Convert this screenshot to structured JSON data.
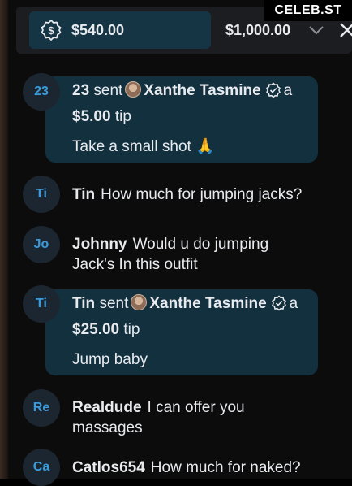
{
  "brand": "CELEB.ST",
  "tipbar": {
    "selected_amount": "$540.00",
    "other_amount": "$1,000.00",
    "icon": "tip-coin-icon"
  },
  "messages": [
    {
      "avatar": "23",
      "type": "tip",
      "user": "23",
      "sent_word": "sent",
      "recipient": "Xanthe Tasmine",
      "a_word": "a",
      "amount": "$5.00",
      "tip_word": "tip",
      "note": "Take a small shot 🙏"
    },
    {
      "avatar": "Ti",
      "type": "chat",
      "user": "Tin",
      "text": "How much for jumping jacks?"
    },
    {
      "avatar": "Jo",
      "type": "chat",
      "user": "Johnny",
      "text": "Would u do jumping",
      "text2": "Jack's In this outfit"
    },
    {
      "avatar": "Ti",
      "type": "tip",
      "user": "Tin",
      "sent_word": "sent",
      "recipient": "Xanthe Tasmine",
      "a_word": "a",
      "amount": "$25.00",
      "tip_word": "tip",
      "note": "Jump baby"
    },
    {
      "avatar": "Re",
      "type": "chat",
      "user": "Realdude",
      "text": "I can offer you",
      "text2": "massages"
    },
    {
      "avatar": "Ca",
      "type": "chat",
      "user": "Catlos654",
      "text": "How much for naked?"
    }
  ]
}
